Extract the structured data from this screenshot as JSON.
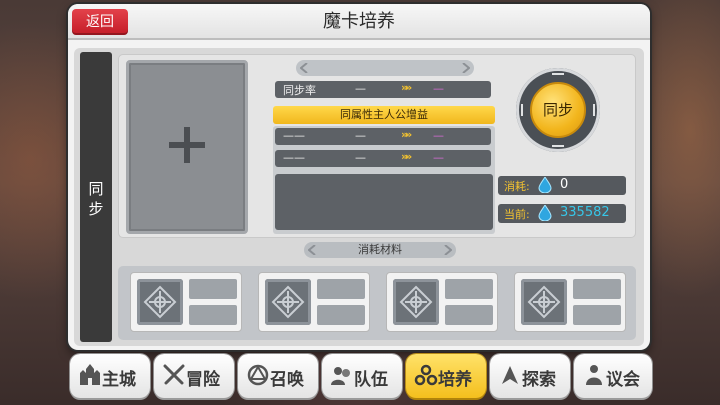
{
  "window": {
    "title": "魔卡培养",
    "back_label": "返回"
  },
  "sidebar": {
    "tab_label_1": "同",
    "tab_label_2": "步"
  },
  "sync_panel": {
    "sync_rate_label": "同步率",
    "sync_rate_current": "—",
    "sync_rate_next": "—",
    "bonus_header": "同属性主人公增益",
    "bonus_rows": [
      {
        "label": "——",
        "current": "—",
        "next": "—"
      },
      {
        "label": "——",
        "current": "—",
        "next": "—"
      }
    ],
    "arrow_glyph": "»"
  },
  "sync_button": {
    "label": "同步"
  },
  "costs": {
    "consume_label": "消耗:",
    "consume_value": "0",
    "current_label": "当前:",
    "current_value": "335582",
    "accent_yellow": "#f2c230",
    "accent_cyan": "#37c6e8"
  },
  "materials": {
    "header": "消耗材料",
    "slots": 4
  },
  "nav": {
    "tabs": [
      {
        "label": "主城",
        "icon": "castle-icon"
      },
      {
        "label": "冒险",
        "icon": "crossed-swords-icon"
      },
      {
        "label": "召唤",
        "icon": "summon-circle-icon"
      },
      {
        "label": "队伍",
        "icon": "team-icon"
      },
      {
        "label": "培养",
        "icon": "cultivate-icon",
        "active": true
      },
      {
        "label": "探索",
        "icon": "explore-icon"
      },
      {
        "label": "议会",
        "icon": "council-icon"
      }
    ]
  }
}
